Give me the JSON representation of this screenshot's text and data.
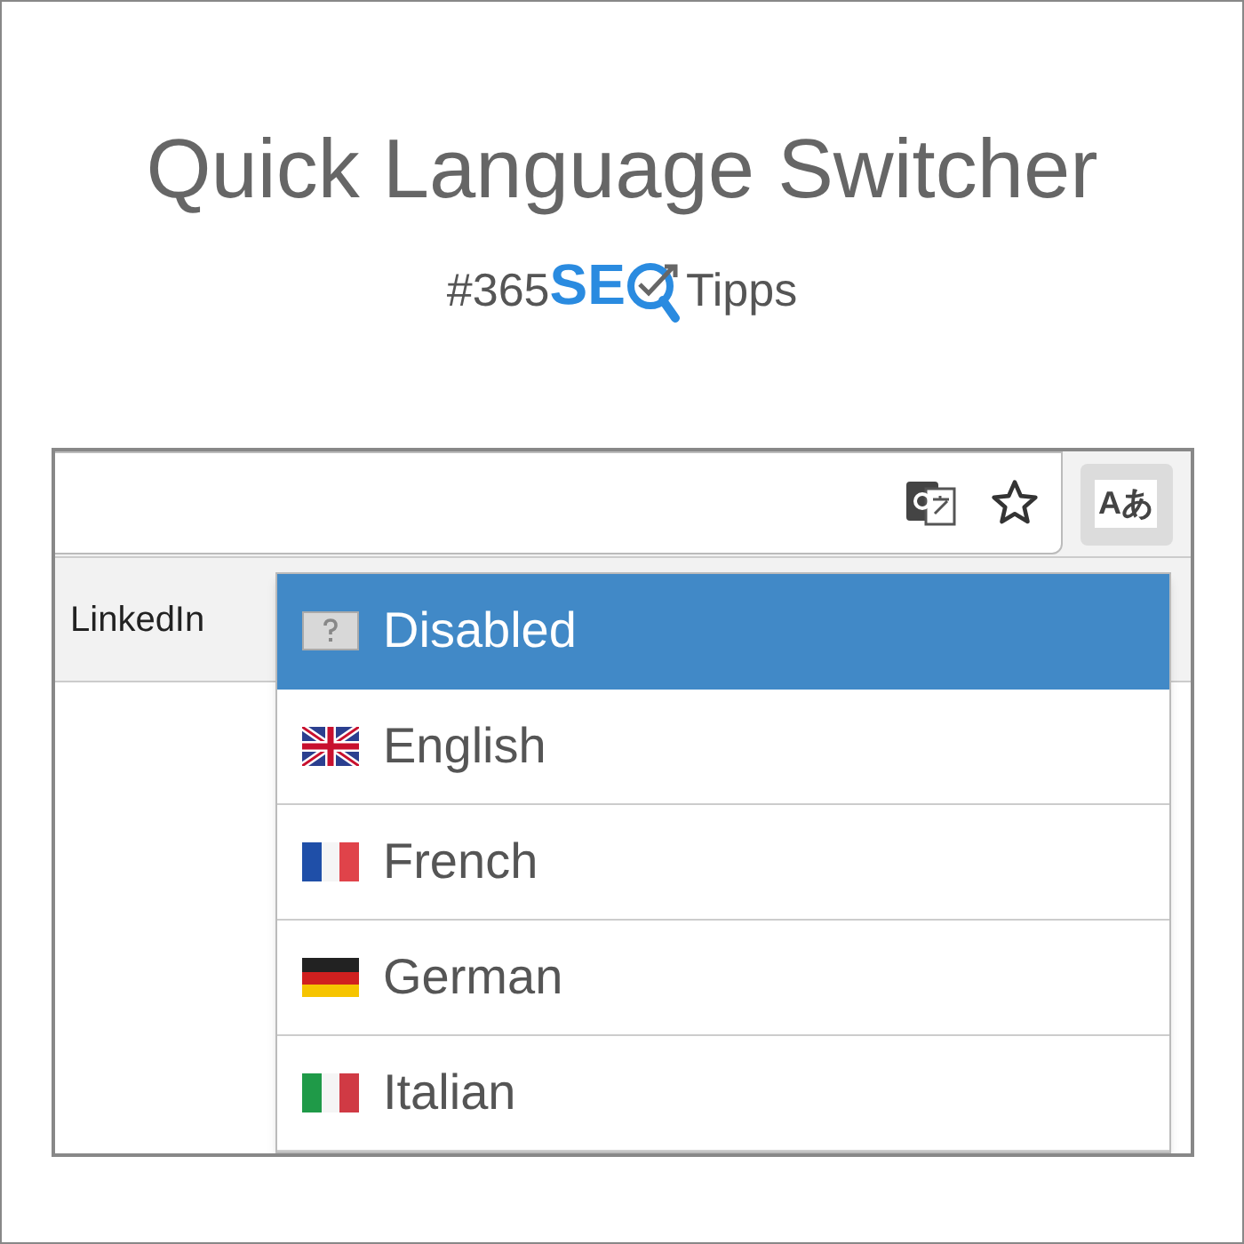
{
  "title": "Quick Language Switcher",
  "logo": {
    "prefix": "#365",
    "brand": "SE",
    "suffix": "Tipps"
  },
  "extension_button": {
    "label": "Aあ"
  },
  "bookmarks": [
    "LinkedIn"
  ],
  "menu": [
    {
      "label": "Disabled",
      "kind": "unknown",
      "selected": true
    },
    {
      "label": "English",
      "kind": "uk",
      "selected": false
    },
    {
      "label": "French",
      "kind": "fr",
      "selected": false
    },
    {
      "label": "German",
      "kind": "de",
      "selected": false
    },
    {
      "label": "Italian",
      "kind": "it",
      "selected": false
    }
  ]
}
